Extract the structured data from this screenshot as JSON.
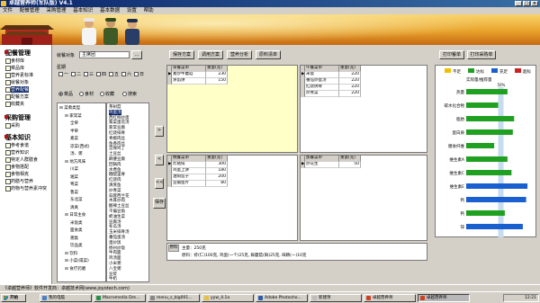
{
  "window": {
    "title": "卓越营养师(军队版) V4.1"
  },
  "menu": [
    "文件",
    "配餐管理",
    "采购管理",
    "基本知识",
    "基本数据",
    "设置",
    "帮助"
  ],
  "sidebar": {
    "sections": [
      {
        "title": "配餐管理",
        "items": [
          "食材库",
          "菜品库",
          "营养素标准",
          "就餐对象",
          "营养配餐",
          "配餐方案",
          "收藏夹"
        ],
        "selected": 4
      },
      {
        "title": "采购管理",
        "items": [
          "采购"
        ]
      },
      {
        "title": "基本知识",
        "items": [
          "参考食谱",
          "营养知识",
          "特定人群膳食",
          "食物搭配",
          "食物相克",
          "药膳与营养",
          "药物与营养素冲突"
        ]
      }
    ]
  },
  "left": {
    "diner_label": "就餐对象",
    "diner_value": "主席团",
    "diner_btn": "...",
    "week_label": "星期",
    "days": [
      "一",
      "二",
      "三",
      "四",
      "五",
      "六",
      "日"
    ],
    "filters": [
      "菜品",
      "食材",
      "收藏",
      "搜索"
    ],
    "tree_a": [
      {
        "label": "菜肴类型",
        "indent": 0
      },
      {
        "label": "家常菜",
        "indent": 1
      },
      {
        "label": "全荤",
        "indent": 2
      },
      {
        "label": "半荤",
        "indent": 2
      },
      {
        "label": "素菜",
        "indent": 2
      },
      {
        "label": "凉菜(西式)",
        "indent": 2
      },
      {
        "label": "汤、粥",
        "indent": 2
      },
      {
        "label": "地方风味",
        "indent": 1
      },
      {
        "label": "川菜",
        "indent": 2
      },
      {
        "label": "湘菜",
        "indent": 2
      },
      {
        "label": "粤菜",
        "indent": 2
      },
      {
        "label": "鲁菜",
        "indent": 2
      },
      {
        "label": "东北菜",
        "indent": 2
      },
      {
        "label": "清真",
        "indent": 2
      },
      {
        "label": "日常主食",
        "indent": 1
      },
      {
        "label": "米饭类",
        "indent": 2
      },
      {
        "label": "面食类",
        "indent": 2
      },
      {
        "label": "粥类",
        "indent": 2
      },
      {
        "label": "饮品类",
        "indent": 2
      },
      {
        "label": "饮料",
        "indent": 1
      },
      {
        "label": "小菜(咸菜)",
        "indent": 1
      },
      {
        "label": "食疗药膳",
        "indent": 1
      }
    ],
    "tree_b": [
      "茶树菇",
      "鸡蛋汤",
      "西红柿炒蛋",
      "紫菜蛋花汤",
      "家常豆腐",
      "红烧排骨",
      "青椒肉丝",
      "鱼香肉丝",
      "宫保鸡丁",
      "土豆丝",
      "麻婆豆腐",
      "回锅肉",
      "水煮鱼",
      "糖醋里脊",
      "红烧肉",
      "清蒸鱼",
      "炒青菜",
      "蒜蓉西兰花",
      "木耳炒肉",
      "酸辣土豆丝",
      "干煸豆角",
      "蚝油生菜",
      "豆腐汤",
      "冬瓜汤",
      "玉米排骨汤",
      "番茄蛋汤",
      "蛋炒饭",
      "扬州炒饭",
      "牛肉面",
      "鸡汤面",
      "小米粥",
      "八宝粥",
      "豆浆",
      "牛奶"
    ]
  },
  "toolbar": {
    "buttons": [
      "保存方案",
      "调用方案",
      "营养分析",
      "原料清单"
    ],
    "right_buttons": [
      "打印餐单",
      "打印采购单"
    ]
  },
  "meals": [
    {
      "header": "早餐菜单",
      "qty_header": "重量(克)",
      "highlight": true,
      "rows": [
        {
          "name": "素炒牛蘑菇",
          "qty": "230"
        },
        {
          "name": "蒸馅饼",
          "qty": "150"
        }
      ]
    },
    {
      "header": "午餐菜单",
      "qty_header": "重量(克)",
      "highlight": false,
      "rows": [
        {
          "name": "米饭",
          "qty": "220"
        },
        {
          "name": "番茄炒蛋汤",
          "qty": "220"
        },
        {
          "name": "红烧牌骨",
          "qty": "220"
        },
        {
          "name": "炒青菜",
          "qty": "220"
        }
      ]
    },
    {
      "header": "晚餐菜单",
      "qty_header": "重量(克)",
      "highlight": false,
      "rows": [
        {
          "name": "炸猪排",
          "qty": "300"
        },
        {
          "name": "鸡蛋上饼",
          "qty": "180"
        },
        {
          "name": "油焖茄子",
          "qty": "200"
        },
        {
          "name": "豆瓣鱼片",
          "qty": "80"
        }
      ]
    },
    {
      "header": "加餐菜单",
      "qty_header": "重量(克)",
      "highlight": false,
      "rows": [
        {
          "name": "炒花生",
          "qty": "50"
        }
      ]
    }
  ],
  "side_buttons": {
    "right": ">",
    "left": "<",
    "all_left": "<<",
    "save": "保存"
  },
  "status_box": {
    "tab": "原料",
    "line1": "主量：250克",
    "line2": "原料：虾(仁)100克, 鸡蛋(一个)25克, 鲜蘑菇(鲜)25克, 味精(一)10克"
  },
  "legend": [
    {
      "label": "不足",
      "color": "#f0c000"
    },
    {
      "label": "达标",
      "color": "#20a020"
    },
    {
      "label": "充足",
      "color": "#1a5fd0"
    },
    {
      "label": "超标",
      "color": "#d02020"
    }
  ],
  "chart_data": {
    "type": "bar",
    "title": "实际量/推荐量",
    "top_tick": "50%",
    "bottom_tick": "150%",
    "categories": [
      "热量",
      "碳水化合物",
      "脂肪",
      "蛋白质",
      "膳食纤维",
      "维生素A",
      "维生素C",
      "维生素E",
      "钙",
      "钙",
      "锌"
    ],
    "values": [
      0.62,
      0.48,
      0.72,
      0.7,
      0.42,
      0.62,
      0.68,
      0.92,
      0.9,
      0.58,
      0.85
    ],
    "colors": [
      "#20a020",
      "#20a020",
      "#20a020",
      "#20a020",
      "#20a020",
      "#20a020",
      "#20a020",
      "#1a5fd0",
      "#1a5fd0",
      "#20a020",
      "#1a5fd0"
    ]
  },
  "statusbar": {
    "text": "《卓越营养师》软件开发商：卓越技术网(www.joyotech.com)"
  },
  "taskbar": {
    "start": "开始",
    "items": [
      "我的电脑",
      "Macromedia Dre...",
      "menu_s_big001...",
      "yyw_4.1a",
      "Adobe Photosho...",
      "新建项",
      "卓越营养师",
      "卓越营养师"
    ],
    "clock": "12:21"
  }
}
